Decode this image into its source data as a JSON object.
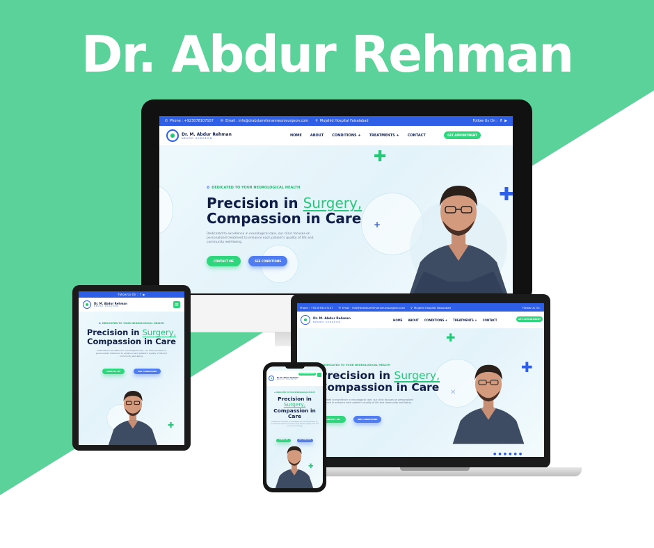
{
  "title": "Dr. Abdur Rehman",
  "colors": {
    "mint": "#5ad29a",
    "brand_blue": "#2f5fe6",
    "brand_green": "#2fd67e",
    "navy": "#0f1d47"
  },
  "site": {
    "topbar": {
      "phone_label": "Phone : +923078107107",
      "email_label": "Email : info@drabdurrehmanneurosurgeon.com",
      "address_label": "Mujahid Hospital Faisalabad",
      "follow_label": "Follow Us On :",
      "phone_short": "Phone : +923078107107",
      "email_short": "Email : info@drabdurrehmanneurosurgeon.com",
      "address_short": "Mujahid Hospital Faisalabad"
    },
    "logo": {
      "name": "Dr. M. Abdur Rehman",
      "subtitle": "NEURO SURGEON"
    },
    "nav": [
      "HOME",
      "ABOUT",
      "CONDITIONS +",
      "TREATMENTS +",
      "CONTACT"
    ],
    "appointment_label": "GET APPOINTMENT",
    "hero": {
      "eyebrow": "DEDICATED TO YOUR NEUROLOGICAL HEALTH",
      "headline_line1_a": "Precision in ",
      "headline_highlight": "Surgery,",
      "headline_line2": "Compassion in Care",
      "description": "Dedicated to excellence in neurological care, our clinic focuses on personalized treatment to enhance each patient's quality of life and community well-being.",
      "cta_primary": "CONTACT ME",
      "cta_secondary": "SEE CONDITIONS"
    }
  }
}
